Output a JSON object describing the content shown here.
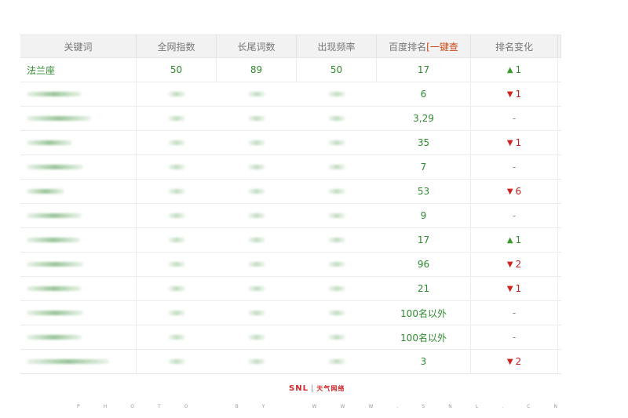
{
  "table": {
    "headers": {
      "keyword": "关键词",
      "index": "全网指数",
      "longtail": "长尾词数",
      "freq": "出现频率",
      "rank_prefix": "百度排名",
      "rank_link": "[一键查",
      "change": "排名变化"
    },
    "first_row": {
      "keyword": "法兰座",
      "index": "50",
      "longtail": "89",
      "freq": "50",
      "rank": "17",
      "change": "1"
    },
    "blurred_rows": [
      {
        "rank": "6",
        "dir": "down",
        "change": "1"
      },
      {
        "rank": "3,29",
        "dir": "none",
        "change": "-"
      },
      {
        "rank": "35",
        "dir": "down",
        "change": "1"
      },
      {
        "rank": "7",
        "dir": "none",
        "change": "-"
      },
      {
        "rank": "53",
        "dir": "down",
        "change": "6"
      },
      {
        "rank": "9",
        "dir": "none",
        "change": "-"
      },
      {
        "rank": "17",
        "dir": "up",
        "change": "1"
      },
      {
        "rank": "96",
        "dir": "down",
        "change": "2"
      },
      {
        "rank": "21",
        "dir": "down",
        "change": "1"
      },
      {
        "rank": "100名以外",
        "dir": "none",
        "change": "-"
      },
      {
        "rank": "100名以外",
        "dir": "none",
        "change": "-"
      },
      {
        "rank": "3",
        "dir": "down",
        "change": "2"
      }
    ]
  },
  "footer": {
    "logo": "SNL",
    "logo_sep": "|",
    "logo_cn": "天气网络",
    "credit_letters": [
      "P",
      "H",
      "O",
      "T",
      "O",
      " ",
      "B",
      "Y",
      " ",
      "W",
      "W",
      "W",
      ".",
      "S",
      "N",
      "L",
      ".",
      "C",
      "N"
    ]
  },
  "colors": {
    "text_green": "#2e8b2e",
    "header_bg": "#f2f2f2",
    "link_orange": "#d04a1a",
    "down_red": "#d02424",
    "up_green": "#3a9a2a"
  }
}
